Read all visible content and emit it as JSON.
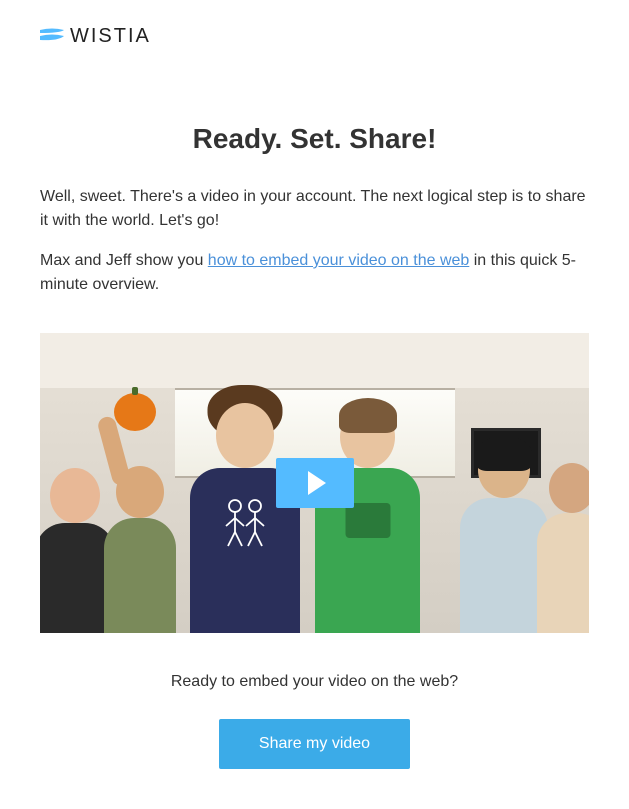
{
  "logo": {
    "text": "WISTIA"
  },
  "heading": "Ready. Set. Share!",
  "intro_text": "Well, sweet. There's a video in your account. The next logical step is to share it with the world. Let's go!",
  "body_prefix": "Max and Jeff show you ",
  "body_link": "how to embed your video on the web",
  "body_suffix": " in this quick 5-minute overview.",
  "cta_prompt": "Ready to embed your video on the web?",
  "cta_button": "Share my video",
  "colors": {
    "accent": "#3babe8",
    "link": "#4a90d9"
  }
}
